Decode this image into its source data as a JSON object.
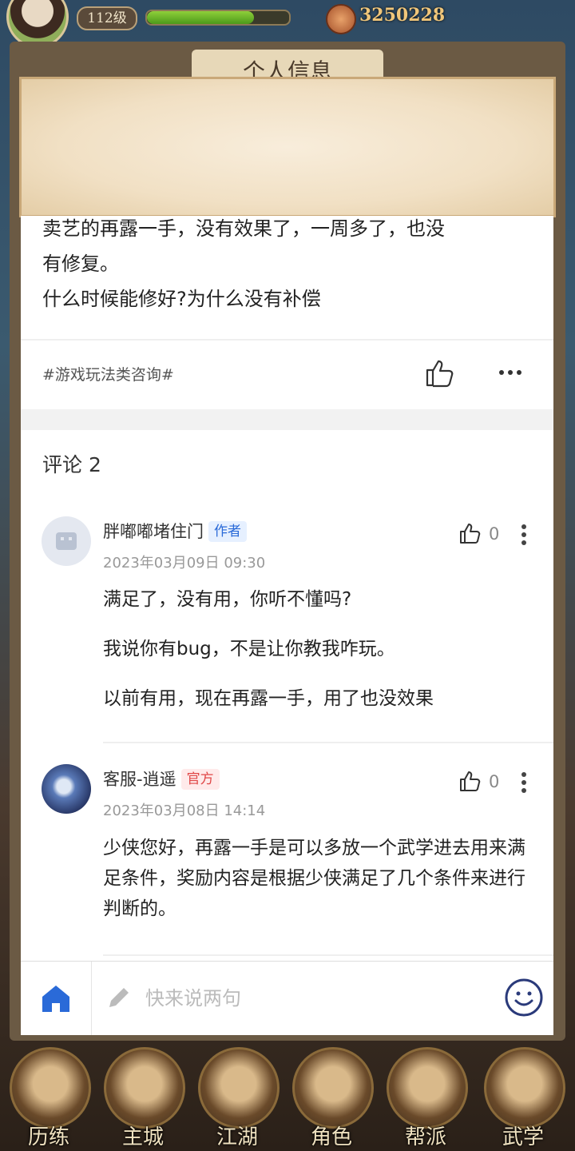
{
  "hud": {
    "level": "112级",
    "coins": "3250228",
    "exp_fraction": 0.75
  },
  "frame_title": "个人信息",
  "post": {
    "text_lines": [
      "卖艺的再露一手，没有效果了，一周多了，也没",
      "有修复。",
      "什么时候能修好?为什么没有补偿"
    ],
    "topic_tag": "#游戏玩法类咨询#"
  },
  "comments_title": "评论 2",
  "comments": [
    {
      "username": "胖嘟嘟堵住门",
      "badge": "作者",
      "time": "2023年03月09日 09:30",
      "likes": "0",
      "body": [
        "满足了，没有用，你听不懂吗?",
        "我说你有bug，不是让你教我咋玩。",
        "以前有用，现在再露一手，用了也没效果"
      ]
    },
    {
      "username": "客服-逍遥",
      "badge": "官方",
      "time": "2023年03月08日 14:14",
      "likes": "0",
      "body": [
        "少侠您好，再露一手是可以多放一个武学进去用来满足条件，奖励内容是根据少侠满足了几个条件来进行判断的。"
      ]
    }
  ],
  "input": {
    "placeholder": "快来说两句"
  },
  "game_nav": [
    "历练",
    "主城",
    "江湖",
    "角色",
    "帮派",
    "武学"
  ],
  "colors": {
    "accent_blue": "#2a6ad8",
    "official_red": "#e04848"
  }
}
